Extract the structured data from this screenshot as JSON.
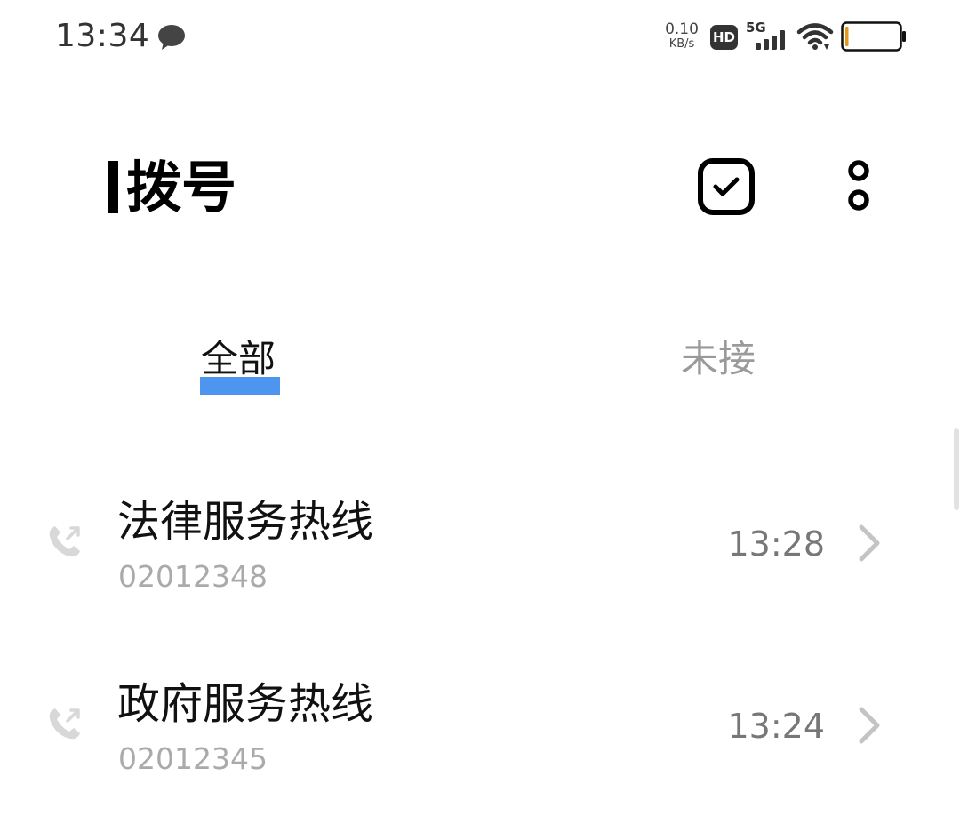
{
  "status_bar": {
    "time": "13:34",
    "net_speed_value": "0.10",
    "net_speed_unit": "KB/s",
    "hd_label": "HD",
    "network_type": "5G",
    "icons": [
      "message-icon",
      "hd-icon",
      "signal-icon",
      "wifi-icon",
      "battery-icon"
    ]
  },
  "header": {
    "title": "拨号",
    "actions": [
      "select-icon",
      "more-icon"
    ]
  },
  "tabs": [
    {
      "label": "全部",
      "selected": true
    },
    {
      "label": "未接",
      "selected": false
    }
  ],
  "calls": [
    {
      "name": "法律服务热线",
      "number": "02012348",
      "time": "13:28",
      "icon": "outgoing-call-icon"
    },
    {
      "name": "政府服务热线",
      "number": "02012345",
      "time": "13:24",
      "icon": "outgoing-call-icon"
    }
  ],
  "colors": {
    "accent": "#4d95ee",
    "text_primary": "#111111",
    "text_secondary": "#aaaaaa",
    "tab_inactive": "#9a9a9a",
    "battery_low": "#e39a1c"
  }
}
